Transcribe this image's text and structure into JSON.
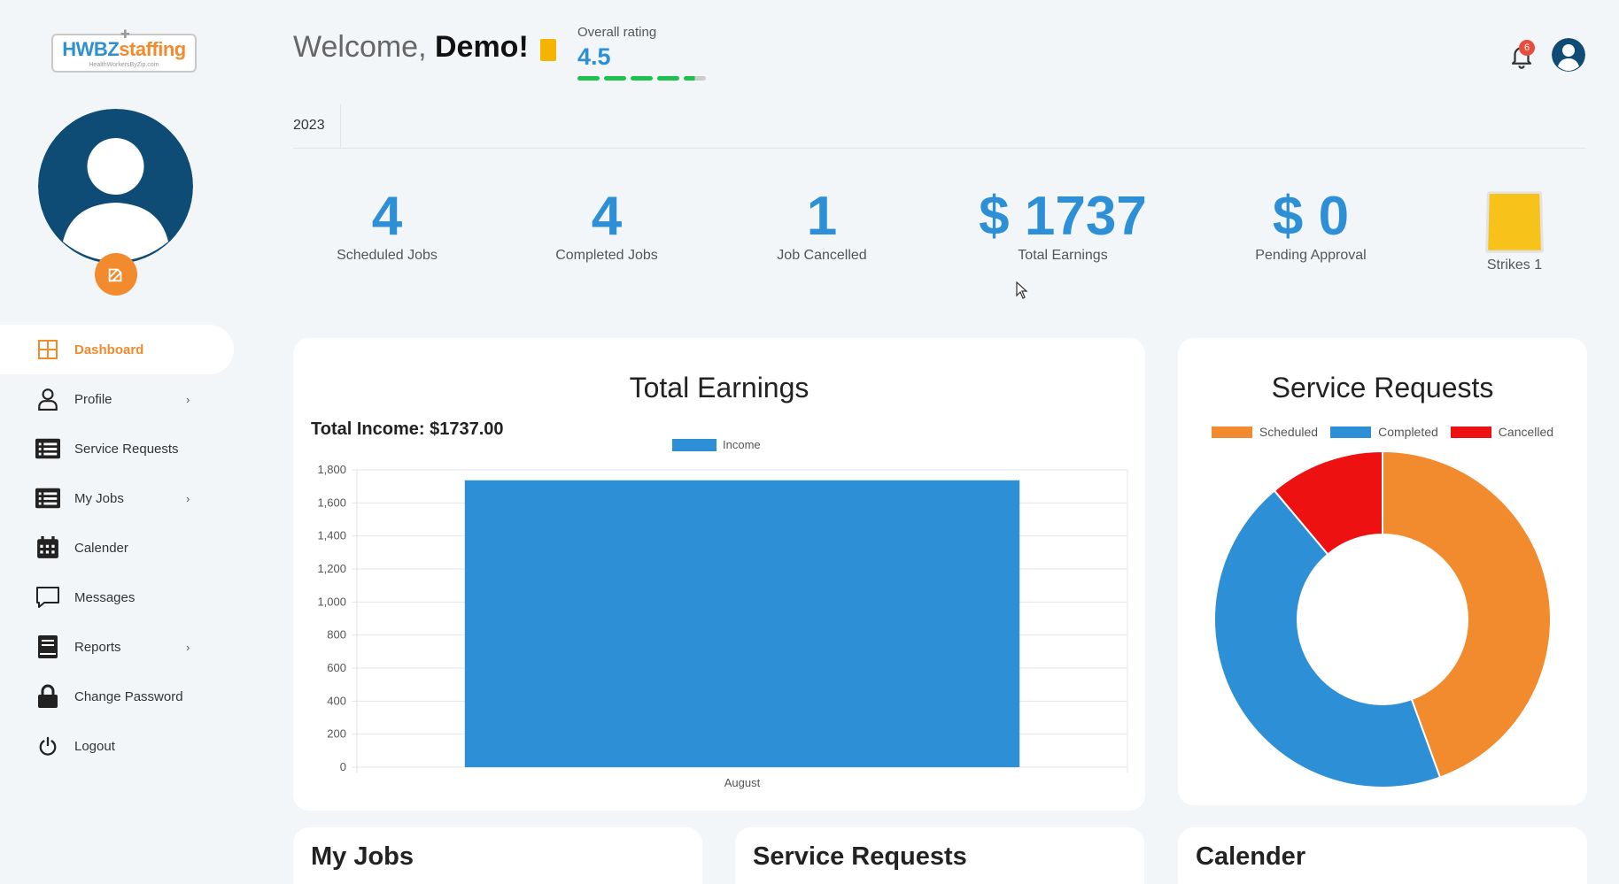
{
  "logo": {
    "main_a": "HWBZ",
    "main_b": "staffing",
    "sub": "HealthWorkersByZip.com"
  },
  "nav": {
    "dashboard": "Dashboard",
    "profile": "Profile",
    "service_requests": "Service Requests",
    "my_jobs": "My Jobs",
    "calender": "Calender",
    "messages": "Messages",
    "reports": "Reports",
    "change_password": "Change Password",
    "logout": "Logout",
    "chevron": "›"
  },
  "header": {
    "welcome_prefix": "Welcome,",
    "welcome_name": "Demo!",
    "rating_label": "Overall rating",
    "rating_value": "4.5",
    "notification_count": "6",
    "year_tab": "2023"
  },
  "stats": {
    "scheduled_value": "4",
    "scheduled_label": "Scheduled Jobs",
    "completed_value": "4",
    "completed_label": "Completed Jobs",
    "cancelled_value": "1",
    "cancelled_label": "Job Cancelled",
    "earnings_value": "$ 1737",
    "earnings_label": "Total Earnings",
    "pending_value": "$ 0",
    "pending_label": "Pending Approval",
    "strikes_label": "Strikes 1"
  },
  "earnings_card": {
    "title": "Total Earnings",
    "total_income": "Total Income: $1737.00"
  },
  "service_card": {
    "title": "Service Requests"
  },
  "bottom_cards": {
    "my_jobs": "My Jobs",
    "service_requests": "Service Requests",
    "calender": "Calender"
  },
  "colors": {
    "accent": "#2d8fd5",
    "orange": "#f28a2e",
    "red": "#ee1111",
    "green": "#1fc24f"
  },
  "chart_data": [
    {
      "type": "bar",
      "title": "",
      "categories": [
        "August"
      ],
      "series": [
        {
          "name": "Income",
          "values": [
            1737
          ],
          "color": "#2d8fd5"
        }
      ],
      "ylim": [
        0,
        1800
      ],
      "yticks": [
        0,
        200,
        400,
        600,
        800,
        1000,
        1200,
        1400,
        1600,
        1800
      ],
      "ytick_labels": [
        "0",
        "200",
        "400",
        "600",
        "800",
        "1,000",
        "1,200",
        "1,400",
        "1,600",
        "1,800"
      ],
      "legend": "top",
      "grid": true
    },
    {
      "type": "pie",
      "style": "doughnut",
      "labels": [
        "Scheduled",
        "Completed",
        "Cancelled"
      ],
      "values": [
        4,
        4,
        1
      ],
      "colors": [
        "#f28a2e",
        "#2d8fd5",
        "#ee1111"
      ],
      "legend": "top"
    }
  ]
}
